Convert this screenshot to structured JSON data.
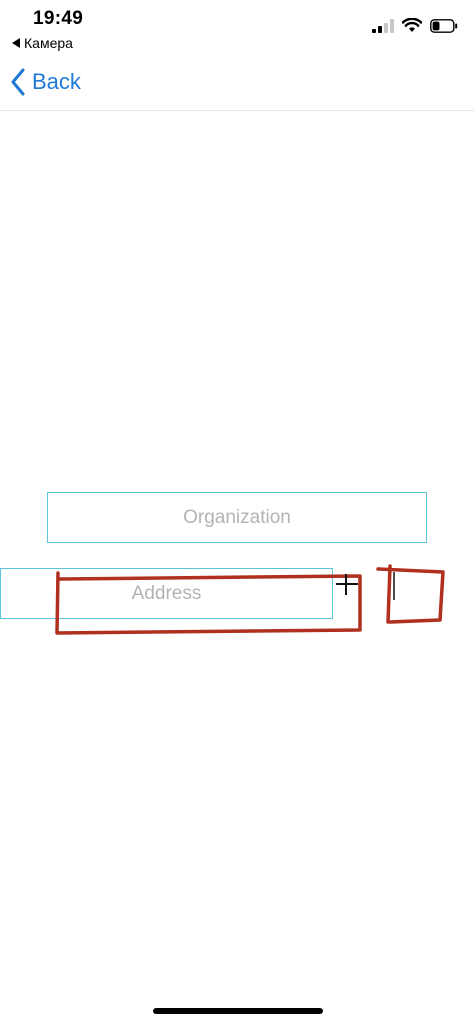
{
  "status_bar": {
    "time": "19:49",
    "back_app_label": "Камера",
    "battery_level": 0.35
  },
  "nav": {
    "back_label": "Back"
  },
  "form": {
    "organization_placeholder": "Organization",
    "address_placeholder": "Address"
  },
  "colors": {
    "accent": "#1f7ad6",
    "field_border": "#5cc5d8",
    "annotation_red": "#b03020",
    "placeholder": "#b3b3b3"
  }
}
